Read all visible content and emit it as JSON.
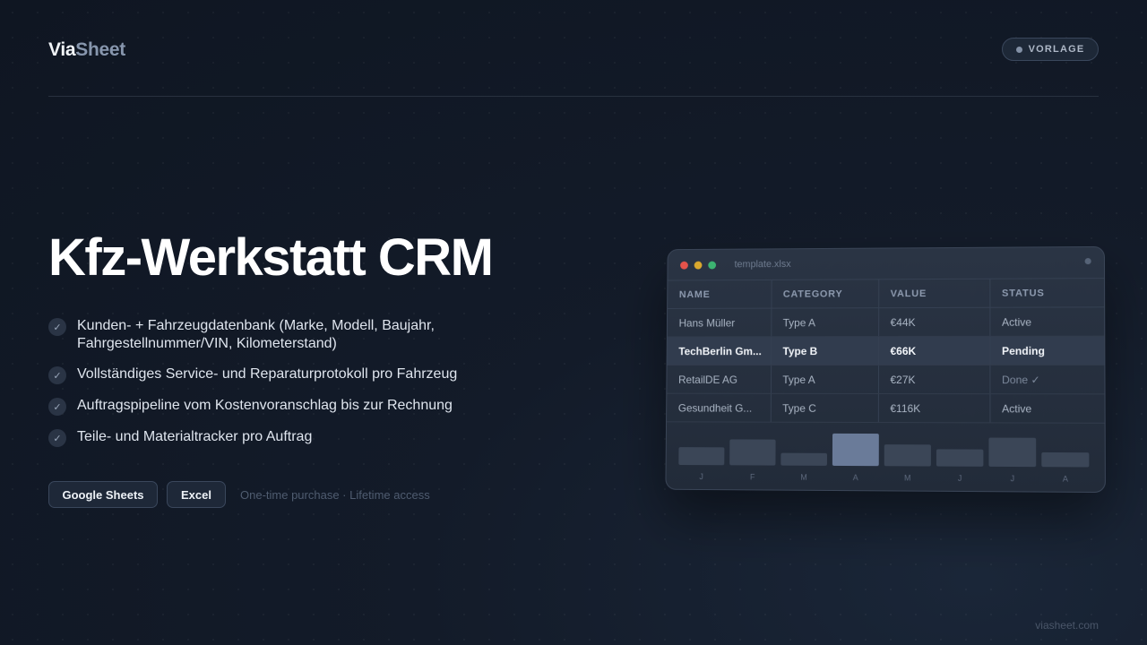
{
  "brand": {
    "part1": "Via",
    "part2": "Sheet"
  },
  "badge": {
    "label": "VORLAGE"
  },
  "hero": {
    "title": "Kfz-Werkstatt CRM"
  },
  "features": [
    "Kunden- + Fahrzeugdatenbank (Marke, Modell, Baujahr, Fahrgestellnummer/VIN, Kilometerstand)",
    "Vollständiges Service- und Reparaturprotokoll pro Fahrzeug",
    "Auftragspipeline vom Kostenvoranschlag bis zur Rechnung",
    "Teile- und Materialtracker pro Auftrag"
  ],
  "buttons": {
    "google_sheets": "Google Sheets",
    "excel": "Excel"
  },
  "purchase_note": "One-time purchase · Lifetime access",
  "footer": {
    "url": "viasheet.com"
  },
  "preview": {
    "filename": "template.xlsx",
    "columns": [
      "NAME",
      "CATEGORY",
      "VALUE",
      "STATUS"
    ],
    "rows": [
      [
        "Hans Müller",
        "Type A",
        "€44K",
        "Active"
      ],
      [
        "TechBerlin Gm...",
        "Type B",
        "€66K",
        "Pending"
      ],
      [
        "RetailDE AG",
        "Type A",
        "€27K",
        "Done ✓"
      ],
      [
        "Gesundheit G...",
        "Type C",
        "€116K",
        "Active"
      ]
    ],
    "highlighted_row": 1,
    "chart_months": [
      "J",
      "F",
      "M",
      "A",
      "M",
      "J",
      "J",
      "A"
    ],
    "chart_values": [
      20,
      29,
      14,
      36,
      24,
      19,
      32,
      16
    ],
    "chart_active_index": 3
  }
}
